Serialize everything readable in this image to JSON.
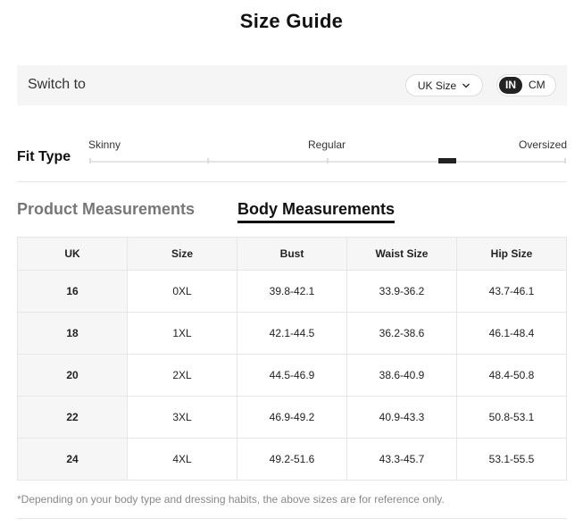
{
  "title": "Size Guide",
  "switch": {
    "label": "Switch to",
    "size_system": "UK Size",
    "units": [
      "IN",
      "CM"
    ],
    "active_unit": "IN"
  },
  "fit": {
    "label": "Fit Type",
    "ticks": [
      "Skinny",
      "Regular",
      "Oversized"
    ],
    "position_fraction": 0.75
  },
  "tabs": [
    {
      "label": "Product Measurements",
      "active": false
    },
    {
      "label": "Body Measurements",
      "active": true
    }
  ],
  "table": {
    "headers": [
      "UK",
      "Size",
      "Bust",
      "Waist Size",
      "Hip Size"
    ],
    "rows": [
      [
        "16",
        "0XL",
        "39.8-42.1",
        "33.9-36.2",
        "43.7-46.1"
      ],
      [
        "18",
        "1XL",
        "42.1-44.5",
        "36.2-38.6",
        "46.1-48.4"
      ],
      [
        "20",
        "2XL",
        "44.5-46.9",
        "38.6-40.9",
        "48.4-50.8"
      ],
      [
        "22",
        "3XL",
        "46.9-49.2",
        "40.9-43.3",
        "50.8-53.1"
      ],
      [
        "24",
        "4XL",
        "49.2-51.6",
        "43.3-45.7",
        "53.1-55.5"
      ]
    ]
  },
  "footnote": "*Depending on your body type and dressing habits, the above sizes are for reference only.",
  "icons": {
    "dropdown": "chevron-down-icon"
  }
}
